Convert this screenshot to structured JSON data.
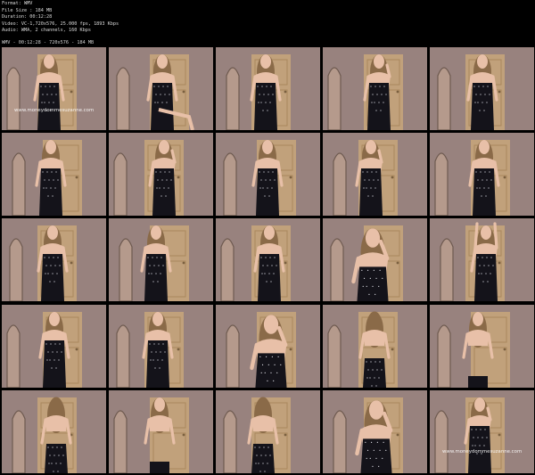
{
  "file_info": {
    "format": "Format: WMV",
    "file_size": "File Size : 184 MB",
    "duration": "Duration: 00:12:28",
    "video": "Video: VC-1,720x576, 25.000 fps, 1893 Kbps",
    "audio": "Audio: WMA, 2 channels, 160 Kbps"
  },
  "caption": "WMV - 00:12:28 - 720x576 - 184 MB",
  "watermark": "www.moneydommesuzanne.com",
  "colors": {
    "background": "#000000",
    "wall": "#a58f8a",
    "door": "#c8a77a",
    "dress": "#14131a",
    "skin": "#e8c0a8",
    "hair": "#8a6a48"
  },
  "thumbnails": [
    {
      "pose": "standing-arms-folded",
      "watermark": true
    },
    {
      "pose": "seated-legs"
    },
    {
      "pose": "standing-hand-hip"
    },
    {
      "pose": "standing-hand-face"
    },
    {
      "pose": "side-turn"
    },
    {
      "pose": "standing-arms-down"
    },
    {
      "pose": "standing-hand-face"
    },
    {
      "pose": "standing-hands-hips"
    },
    {
      "pose": "standing-hand-face"
    },
    {
      "pose": "bent-side"
    },
    {
      "pose": "hands-at-chest"
    },
    {
      "pose": "hands-at-chest"
    },
    {
      "pose": "hands-at-chest"
    },
    {
      "pose": "close-up-face"
    },
    {
      "pose": "arms-up"
    },
    {
      "pose": "standing-door"
    },
    {
      "pose": "arms-out"
    },
    {
      "pose": "close-up-face"
    },
    {
      "pose": "back-turned"
    },
    {
      "pose": "topless-front"
    },
    {
      "pose": "back-turned"
    },
    {
      "pose": "topless-front"
    },
    {
      "pose": "back-turned-hair"
    },
    {
      "pose": "close-up-face"
    },
    {
      "pose": "hand-face",
      "watermark": true
    }
  ]
}
